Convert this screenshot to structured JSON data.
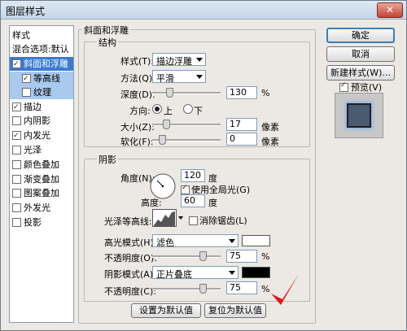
{
  "window": {
    "title": "图层样式",
    "close_label": "✕"
  },
  "style_list": {
    "items": [
      {
        "label": "样式",
        "checkbox": null,
        "indent": 0,
        "state": "header"
      },
      {
        "label": "混合选项:默认",
        "checkbox": null,
        "indent": 0,
        "state": "header"
      },
      {
        "label": "斜面和浮雕",
        "checkbox": true,
        "indent": 0,
        "state": "selected"
      },
      {
        "label": "等高线",
        "checkbox": true,
        "indent": 1,
        "state": "subselected"
      },
      {
        "label": "纹理",
        "checkbox": false,
        "indent": 1,
        "state": "subselected"
      },
      {
        "label": "描边",
        "checkbox": true,
        "indent": 0,
        "state": "normal"
      },
      {
        "label": "内阴影",
        "checkbox": false,
        "indent": 0,
        "state": "normal"
      },
      {
        "label": "内发光",
        "checkbox": true,
        "indent": 0,
        "state": "normal"
      },
      {
        "label": "光泽",
        "checkbox": false,
        "indent": 0,
        "state": "normal"
      },
      {
        "label": "颜色叠加",
        "checkbox": false,
        "indent": 0,
        "state": "normal"
      },
      {
        "label": "渐变叠加",
        "checkbox": false,
        "indent": 0,
        "state": "normal"
      },
      {
        "label": "图案叠加",
        "checkbox": false,
        "indent": 0,
        "state": "normal"
      },
      {
        "label": "外发光",
        "checkbox": false,
        "indent": 0,
        "state": "normal"
      },
      {
        "label": "投影",
        "checkbox": false,
        "indent": 0,
        "state": "normal"
      }
    ]
  },
  "bevel": {
    "section_title": "斜面和浮雕",
    "structure_title": "结构",
    "style_label": "样式(T):",
    "style_value": "描边浮雕",
    "technique_label": "方法(Q):",
    "technique_value": "平滑",
    "depth_label": "深度(D):",
    "depth_value": "130",
    "depth_unit": "%",
    "depth_level": 0.13,
    "direction_label": "方向:",
    "direction_up": "上",
    "direction_down": "下",
    "direction_selected": "up",
    "size_label": "大小(Z):",
    "size_value": "17",
    "size_unit": "像素",
    "size_level": 0.07,
    "soften_label": "软化(F):",
    "soften_value": "0",
    "soften_unit": "像素",
    "soften_level": 0.0
  },
  "shading": {
    "title": "阴影",
    "angle_label": "角度(N):",
    "angle_value": "120",
    "angle_unit": "度",
    "global_light_label": "使用全局光(G)",
    "global_light_checked": true,
    "altitude_label": "高度:",
    "altitude_value": "60",
    "altitude_unit": "度",
    "gloss_label": "光泽等高线:",
    "antialias_label": "消除锯齿(L)",
    "antialias_checked": false,
    "highlight_mode_label": "高光模式(H):",
    "highlight_mode_value": "滤色",
    "highlight_color": "#ffffff",
    "highlight_opacity_label": "不透明度(O):",
    "highlight_opacity_value": "75",
    "highlight_opacity_unit": "%",
    "highlight_opacity_level": 0.75,
    "shadow_mode_label": "阴影模式(A):",
    "shadow_mode_value": "正片叠底",
    "shadow_color": "#000000",
    "shadow_opacity_label": "不透明度(C):",
    "shadow_opacity_value": "75",
    "shadow_opacity_unit": "%",
    "shadow_opacity_level": 0.75
  },
  "footer": {
    "set_default_label": "设置为默认值",
    "reset_default_label": "复位为默认值"
  },
  "buttons": {
    "ok": "确定",
    "cancel": "取消",
    "new_style": "新建样式(W)...",
    "preview_label": "预览(V)",
    "preview_checked": true
  }
}
